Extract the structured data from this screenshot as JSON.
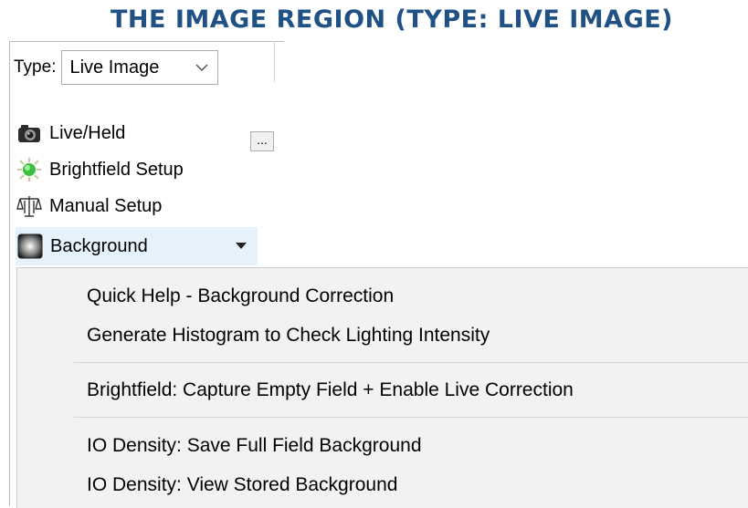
{
  "heading": "THE IMAGE REGION (TYPE: LIVE IMAGE)",
  "colors": {
    "heading": "#1f5185",
    "highlight": "#e5f1fb",
    "menu_bg": "#f2f2f2"
  },
  "type_selector": {
    "label": "Type:",
    "value": "Live Image"
  },
  "tools": [
    {
      "label": "Live/Held",
      "icon": "camera-icon"
    },
    {
      "label": "Brightfield Setup",
      "icon": "bulb-icon"
    },
    {
      "label": "Manual Setup",
      "icon": "balance-scale-icon"
    },
    {
      "label": "Background",
      "icon": "background-gradient-icon"
    }
  ],
  "ellipsis_label": "...",
  "menu": [
    "Quick Help - Background Correction",
    "Generate Histogram to Check Lighting Intensity",
    "Brightfield: Capture Empty Field + Enable Live Correction",
    "IO Density: Save Full Field Background",
    "IO Density: View Stored Background"
  ]
}
